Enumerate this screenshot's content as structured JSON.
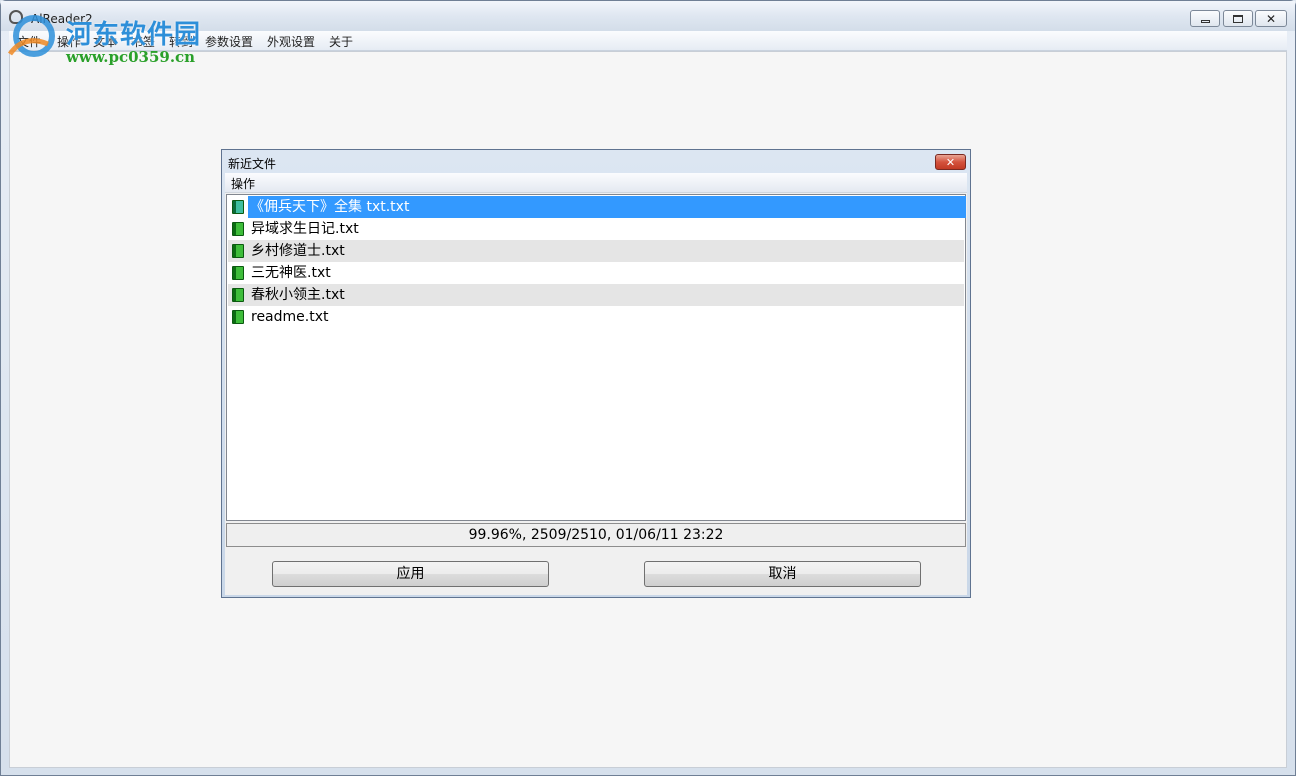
{
  "window": {
    "title": "AlReader2"
  },
  "menubar": {
    "items": [
      "文件",
      "操作",
      "文本",
      "书签",
      "转到",
      "参数设置",
      "外观设置",
      "关于"
    ]
  },
  "watermark": {
    "text": "河东软件园",
    "url": "www.pc0359.cn"
  },
  "dialog": {
    "title": "新近文件",
    "menu": "操作",
    "files": [
      {
        "name": "《佣兵天下》全集 txt.txt",
        "selected": true
      },
      {
        "name": "异域求生日记.txt",
        "selected": false
      },
      {
        "name": "乡村修道士.txt",
        "selected": false
      },
      {
        "name": "三无神医.txt",
        "selected": false
      },
      {
        "name": "春秋小领主.txt",
        "selected": false
      },
      {
        "name": "readme.txt",
        "selected": false
      }
    ],
    "status": "99.96%, 2509/2510, 01/06/11 23:22",
    "apply_label": "应用",
    "cancel_label": "取消"
  },
  "colors": {
    "selection": "#3399ff",
    "accent": "#2d8fd9"
  }
}
